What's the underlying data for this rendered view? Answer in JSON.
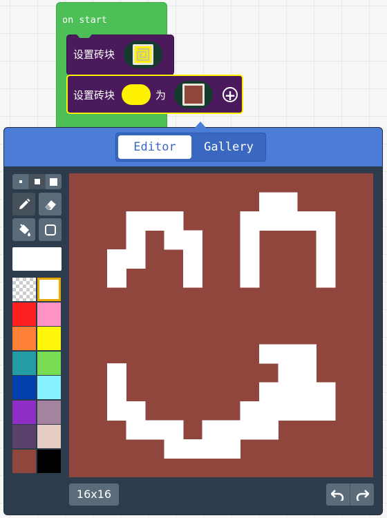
{
  "event_block": {
    "label": "on start"
  },
  "set_tile_block": {
    "label": "设置砖块"
  },
  "set_tile_as_block": {
    "label": "设置砖块",
    "as_label": "为"
  },
  "editor": {
    "tabs": {
      "editor": "Editor",
      "gallery": "Gallery"
    },
    "active_tab": "Editor",
    "tools": [
      "pencil-icon",
      "eraser-icon",
      "fill-bucket-icon",
      "rectangle-icon"
    ],
    "active_tool": "pencil-icon",
    "brush_sizes": [
      "small",
      "medium",
      "large"
    ],
    "active_brush_size": "medium",
    "current_color": "#ffffff",
    "palette": [
      "transparent",
      "#ffffff",
      "#ff2121",
      "#ff93c4",
      "#ff8135",
      "#fff609",
      "#249ca3",
      "#78dc52",
      "#003fad",
      "#87f2ff",
      "#8e2ec4",
      "#a4839f",
      "#5c406c",
      "#e5cdc4",
      "#91463d",
      "#000000"
    ],
    "selected_palette_index": 1,
    "canvas_size_label": "16x16",
    "canvas_background": "#91463d",
    "pixel_rows": [
      "................",
      "..........XX....",
      "...XXX...XXXXX..",
      "...X.XX..X...X..",
      "..XX..X..X...X..",
      "..X...X..X...X..",
      "................",
      "................",
      "................",
      "..........XXX...",
      "..X........XX...",
      "..X.......XXXX..",
      "..XX.....XXXXX..",
      "...XXX.XXXX.....",
      ".....XXXX.......",
      "................"
    ]
  }
}
